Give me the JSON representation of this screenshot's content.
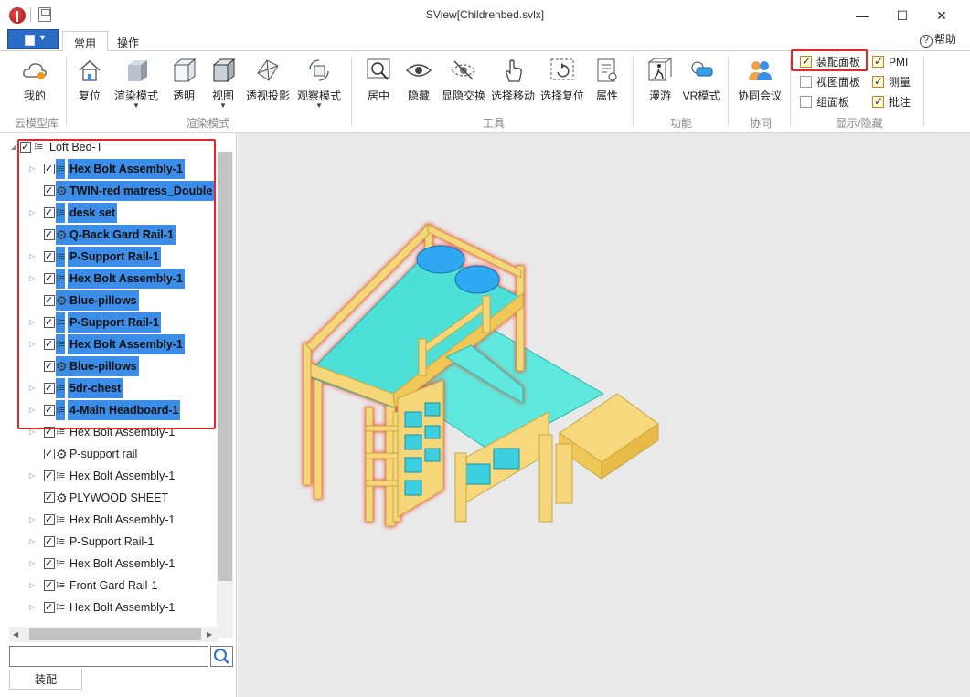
{
  "window": {
    "title": "SView[Childrenbed.svlx]",
    "minimize": "—",
    "maximize": "☐",
    "close": "✕"
  },
  "tabs": [
    {
      "label": "常用",
      "active": true
    },
    {
      "label": "操作",
      "active": false
    }
  ],
  "help_label": "帮助",
  "ribbon": {
    "cloud_group": {
      "label": "云模型库",
      "my_label": "我的"
    },
    "render_group": {
      "label": "渲染模式",
      "buttons": [
        "复位",
        "渲染模式",
        "透明",
        "视图",
        "透视投影",
        "观察模式"
      ]
    },
    "tools_group": {
      "label": "工具",
      "buttons": [
        "居中",
        "隐藏",
        "显隐交换",
        "选择移动",
        "选择复位",
        "属性"
      ]
    },
    "function_group": {
      "label": "功能",
      "buttons": [
        "漫游",
        "VR模式"
      ]
    },
    "collab_group": {
      "label": "协同",
      "buttons": [
        "协同会议"
      ]
    },
    "display_group": {
      "label": "显示/隐藏",
      "checkboxes": [
        {
          "label": "装配面板",
          "checked": true
        },
        {
          "label": "视图面板",
          "checked": false
        },
        {
          "label": "组面板",
          "checked": false
        },
        {
          "label": "PMI",
          "checked": true
        },
        {
          "label": "测量",
          "checked": true
        },
        {
          "label": "批注",
          "checked": true
        }
      ]
    }
  },
  "tree": {
    "root": "Loft Bed-T",
    "items": [
      {
        "label": "Hex Bolt Assembly-1",
        "icon": "assembly",
        "expandable": true,
        "selected": true
      },
      {
        "label": "TWIN-red matress_Double",
        "icon": "part",
        "expandable": false,
        "selected": true
      },
      {
        "label": "desk set",
        "icon": "assembly",
        "expandable": true,
        "selected": true
      },
      {
        "label": "Q-Back Gard Rail-1",
        "icon": "part",
        "expandable": false,
        "selected": true
      },
      {
        "label": "P-Support Rail-1",
        "icon": "assembly",
        "expandable": true,
        "selected": true
      },
      {
        "label": "Hex Bolt Assembly-1",
        "icon": "assembly",
        "expandable": true,
        "selected": true
      },
      {
        "label": "Blue-pillows",
        "icon": "part",
        "expandable": false,
        "selected": true
      },
      {
        "label": "P-Support Rail-1",
        "icon": "assembly",
        "expandable": true,
        "selected": true
      },
      {
        "label": "Hex Bolt Assembly-1",
        "icon": "assembly",
        "expandable": true,
        "selected": true
      },
      {
        "label": "Blue-pillows",
        "icon": "part",
        "expandable": false,
        "selected": true
      },
      {
        "label": "5dr-chest",
        "icon": "assembly",
        "expandable": true,
        "selected": true
      },
      {
        "label": "4-Main Headboard-1",
        "icon": "assembly",
        "expandable": true,
        "selected": true
      },
      {
        "label": "Hex Bolt Assembly-1",
        "icon": "assembly",
        "expandable": true,
        "selected": false
      },
      {
        "label": "P-support rail",
        "icon": "part",
        "expandable": false,
        "selected": false
      },
      {
        "label": "Hex Bolt Assembly-1",
        "icon": "assembly",
        "expandable": true,
        "selected": false
      },
      {
        "label": "PLYWOOD SHEET",
        "icon": "part",
        "expandable": false,
        "selected": false
      },
      {
        "label": "Hex Bolt Assembly-1",
        "icon": "assembly",
        "expandable": true,
        "selected": false
      },
      {
        "label": "P-Support Rail-1",
        "icon": "assembly",
        "expandable": true,
        "selected": false
      },
      {
        "label": "Hex Bolt Assembly-1",
        "icon": "assembly",
        "expandable": true,
        "selected": false
      },
      {
        "label": "Front Gard Rail-1",
        "icon": "assembly",
        "expandable": true,
        "selected": false
      },
      {
        "label": "Hex Bolt Assembly-1",
        "icon": "assembly",
        "expandable": true,
        "selected": false
      }
    ]
  },
  "search": {
    "value": ""
  },
  "bottom_tab": "装配",
  "colors": {
    "accent": "#2b6cc4",
    "selection": "#3b8de8",
    "highlight": "#e5262b",
    "wood": "#f5d77a",
    "mattress": "#4de0d8"
  }
}
